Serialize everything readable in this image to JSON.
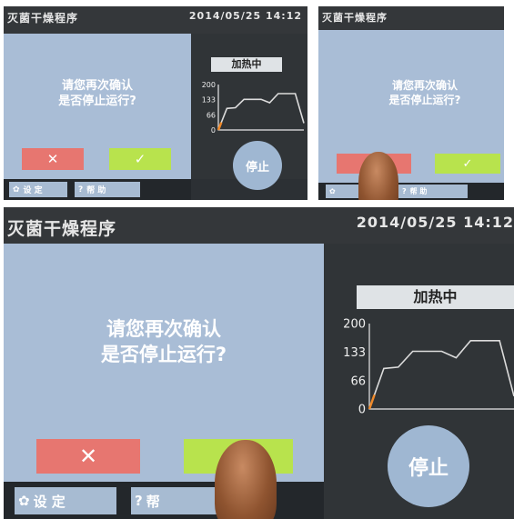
{
  "screen": {
    "title": "灭菌干燥程序",
    "datetime": "2014/05/25 14:12",
    "prompt_line1": "请您再次确认",
    "prompt_line2": "是否停止运行?",
    "cancel_symbol": "✕",
    "confirm_symbol": "✓",
    "status": "加热中",
    "stop_label": "停止",
    "settings_label": "设 定",
    "help_label": "帮 助",
    "help_label_cropped": "帮 ",
    "colors": {
      "panel": "#a9bdd6",
      "cancel": "#e77670",
      "confirm": "#b8e34d",
      "background": "#2c3034"
    }
  },
  "chart_data": {
    "type": "line",
    "x": [
      0,
      1,
      2,
      3,
      4,
      5,
      6,
      7,
      8,
      9,
      10
    ],
    "values": [
      0,
      95,
      98,
      135,
      135,
      135,
      120,
      160,
      160,
      160,
      30
    ],
    "y_ticks": [
      "200",
      "133",
      "66",
      "0"
    ],
    "ylim": [
      0,
      200
    ],
    "grid": false
  }
}
